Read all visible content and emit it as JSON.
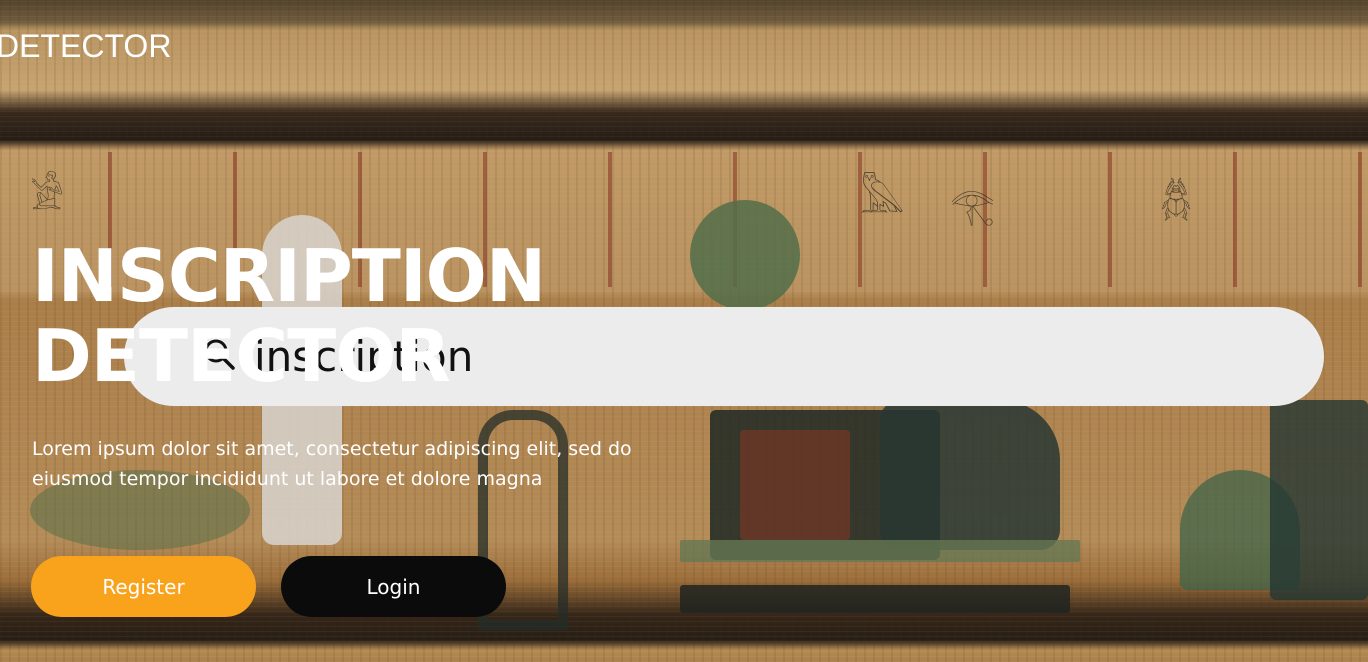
{
  "brand": {
    "name": "DETECTOR"
  },
  "hero": {
    "title": "INSCRIPTION DETECTOR",
    "description": "Lorem ipsum dolor sit amet, consectetur adipiscing elit, sed do eiusmod tempor incididunt ut labore et dolore magna"
  },
  "search": {
    "value": "inscription"
  },
  "buttons": {
    "register": "Register",
    "login": "Login"
  },
  "colors": {
    "accent": "#f8a31b",
    "dark_button": "#0b0b0b",
    "search_bg": "#ececec"
  }
}
